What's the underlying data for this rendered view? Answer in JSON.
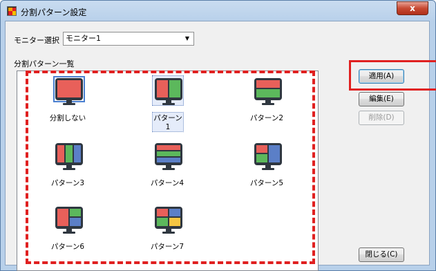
{
  "window": {
    "title": "分割パターン設定",
    "close_glyph": "x"
  },
  "monitor_select": {
    "label": "モニター選択",
    "value": "モニター1"
  },
  "pattern_list": {
    "label": "分割パターン一覧",
    "items": [
      {
        "label": "分割しない",
        "selected": false,
        "focused": true
      },
      {
        "label": "パターン1",
        "selected": true,
        "focused": false
      },
      {
        "label": "パターン2",
        "selected": false,
        "focused": false
      },
      {
        "label": "パターン3",
        "selected": false,
        "focused": false
      },
      {
        "label": "パターン4",
        "selected": false,
        "focused": false
      },
      {
        "label": "パターン5",
        "selected": false,
        "focused": false
      },
      {
        "label": "パターン6",
        "selected": false,
        "focused": false
      },
      {
        "label": "パターン7",
        "selected": false,
        "focused": false
      }
    ]
  },
  "buttons": {
    "apply": "適用(A)",
    "edit": "編集(E)",
    "delete": "削除(D)",
    "close": "閉じる(C)"
  },
  "colors": {
    "red": "#e8605a",
    "green": "#5cb85c",
    "blue": "#5b7fc7",
    "yellow": "#f5c542",
    "annotation": "#e02020"
  }
}
